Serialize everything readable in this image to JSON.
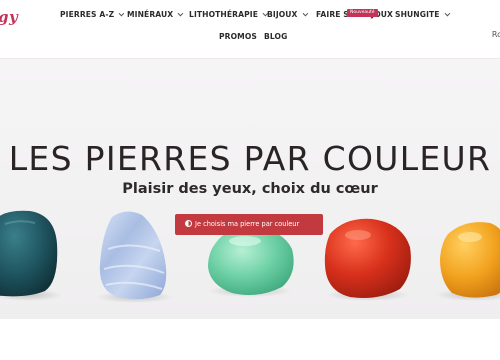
{
  "brand": {
    "logo_text": "gy",
    "color": "#c4345a"
  },
  "nav": {
    "items": [
      {
        "label": "PIERRES A-Z",
        "has_dropdown": true
      },
      {
        "label": "MINÉRAUX",
        "has_dropdown": true
      },
      {
        "label": "LITHOTHÉRAPIE",
        "has_dropdown": true
      },
      {
        "label": "BIJOUX",
        "has_dropdown": true
      },
      {
        "label": "FAIRE SES BIJOUX",
        "has_dropdown": false
      },
      {
        "label": "SHUNGITE",
        "has_dropdown": true
      }
    ],
    "badge_text": "Nouveauté",
    "row2": [
      {
        "label": "PROMOS"
      },
      {
        "label": "BLOG"
      }
    ],
    "edge_text": "Ro"
  },
  "hero": {
    "title": "LES PIERRES PAR COULEUR",
    "subtitle": "Plaisir des yeux, choix du cœur",
    "cta_label": "Je choisis ma pierre par couleur",
    "cta_icon": "half-circle-icon",
    "cta_color": "#c23a3f",
    "stones": [
      {
        "name": "dark-teal-stone",
        "color": "#1f5560"
      },
      {
        "name": "blue-lace-agate-stone",
        "color": "#a9bde3"
      },
      {
        "name": "green-aventurine-stone",
        "color": "#6fd1a6"
      },
      {
        "name": "red-jasper-stone",
        "color": "#d8311c"
      },
      {
        "name": "orange-carnelian-stone",
        "color": "#f2a21e"
      }
    ]
  },
  "colors": {
    "accent": "#c4345a",
    "hero_bg": "#f3f2f3",
    "text_dark": "#2a2426"
  }
}
